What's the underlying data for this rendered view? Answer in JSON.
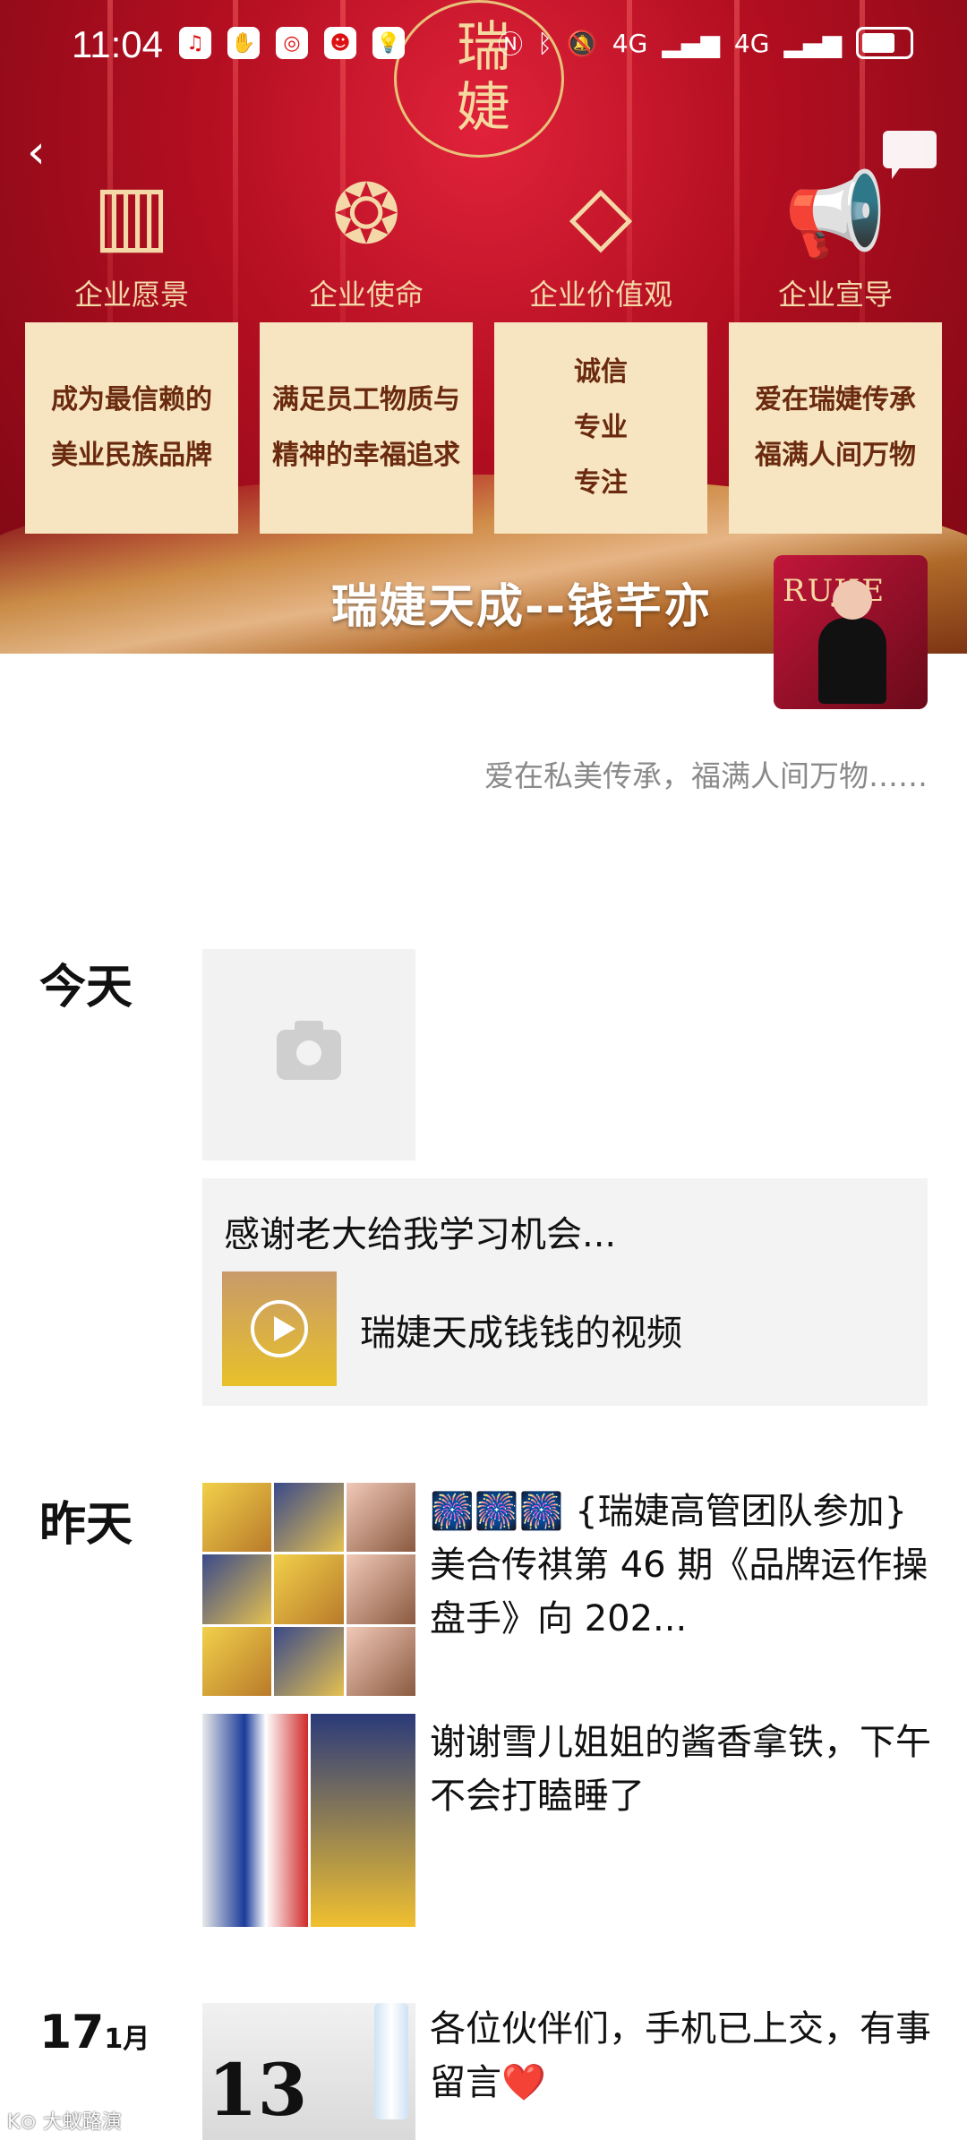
{
  "status_bar": {
    "time": "11:04",
    "network": "4G",
    "network2": "4G"
  },
  "cover": {
    "logo_text": "瑞婕",
    "values": [
      {
        "icon": "building-icon",
        "title": "企业愿景",
        "lines": [
          "成为最信赖的",
          "美业民族品牌"
        ]
      },
      {
        "icon": "medal-icon",
        "title": "企业使命",
        "lines": [
          "满足员工物质与",
          "精神的幸福追求"
        ]
      },
      {
        "icon": "diamond-icon",
        "title": "企业价值观",
        "lines": [
          "诚信",
          "专业",
          "专注"
        ]
      },
      {
        "icon": "megaphone-icon",
        "title": "企业宣导",
        "lines": [
          "爱在瑞婕传承",
          "福满人间万物"
        ]
      }
    ],
    "profile_name": "瑞婕天成--钱芊亦",
    "avatar_text": "RUJIE"
  },
  "signature": "爱在私美传承，福满人间万物……",
  "days": [
    {
      "label": "今天"
    },
    {
      "label": "昨天"
    },
    {
      "label": "17",
      "month": "1月"
    }
  ],
  "today": {
    "share_title": "感谢老大给我学习机会...",
    "video_title": "瑞婕天成钱钱的视频"
  },
  "yesterday": {
    "post1": "🎆🎆🎆 {瑞婕高管团队参加}美合传祺第 46 期《品牌运作操盘手》向 202...",
    "post2": "谢谢雪儿姐姐的酱香拿铁，下午不会打瞌睡了"
  },
  "jan17": {
    "post": "各位伙伴们，手机已上交，有事留言❤️",
    "photo_number": "13"
  },
  "watermark": "K⊙ 大蚁路演"
}
